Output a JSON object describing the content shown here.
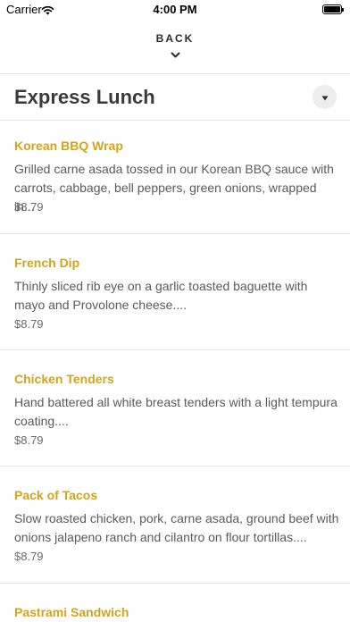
{
  "status_bar": {
    "carrier": "Carrier",
    "time": "4:00 PM"
  },
  "nav": {
    "back_label": "BACK"
  },
  "section": {
    "title": "Express Lunch"
  },
  "menu_items": [
    {
      "name": "Korean BBQ Wrap",
      "description": "Grilled carne asada tossed in our Korean BBQ sauce with carrots, cabbage, bell peppers, green onions, wrapped in...",
      "price": "$8.79"
    },
    {
      "name": "French Dip",
      "description": "Thinly sliced rib eye on a garlic toasted baguette with mayo and Provolone cheese....",
      "price": "$8.79"
    },
    {
      "name": "Chicken Tenders",
      "description": "Hand battered all white breast tenders with a light tempura coating....",
      "price": "$8.79"
    },
    {
      "name": "Pack of Tacos",
      "description": "Slow roasted chicken, pork, carne asada, ground beef with onions jalapeno ranch and cilantro on flour tortillas....",
      "price": "$8.79"
    },
    {
      "name": "Pastrami Sandwich"
    }
  ],
  "colors": {
    "accent": "#d3a419",
    "divider": "#e6e6e6"
  }
}
